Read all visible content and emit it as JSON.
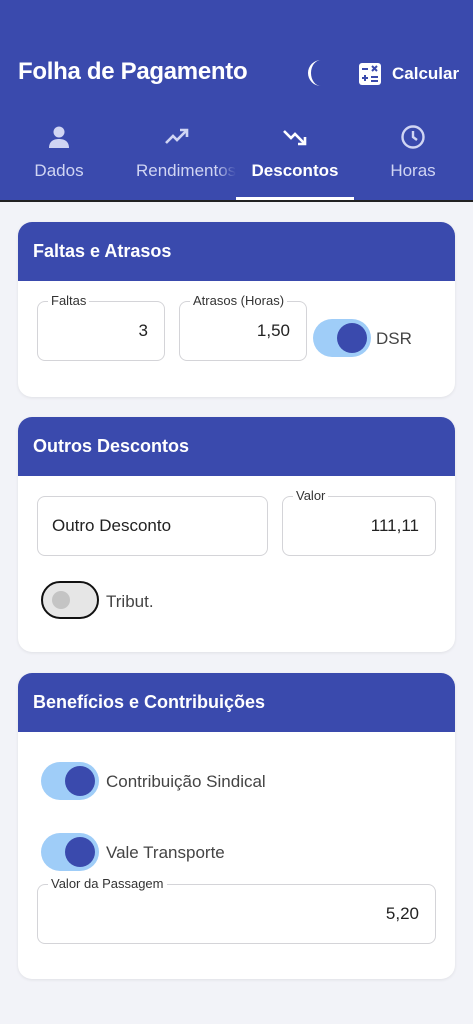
{
  "appbar": {
    "title": "Folha de Pagamento",
    "theme_icon": "moon-icon",
    "calc_icon": "calculator-icon",
    "calc_label": "Calcular"
  },
  "tabs": [
    {
      "label": "Dados",
      "icon": "person-icon",
      "active": false
    },
    {
      "label": "Rendimentos",
      "icon": "trending-up-icon",
      "active": false
    },
    {
      "label": "Descontos",
      "icon": "trending-down-icon",
      "active": true
    },
    {
      "label": "Horas",
      "icon": "clock-icon",
      "active": false
    }
  ],
  "faltas_atrasos": {
    "title": "Faltas e Atrasos",
    "faltas": {
      "label": "Faltas",
      "value": "3"
    },
    "atrasos": {
      "label": "Atrasos (Horas)",
      "value": "1,50"
    },
    "dsr": {
      "label": "DSR",
      "on": true
    }
  },
  "outros": {
    "title": "Outros Descontos",
    "descricao": "Outro Desconto",
    "valor": {
      "label": "Valor",
      "value": "111,11"
    },
    "tribut": {
      "label": "Tribut.",
      "on": false
    }
  },
  "beneficios": {
    "title": "Benefícios e Contribuições",
    "sindical": {
      "label": "Contribuição Sindical",
      "on": true
    },
    "transporte": {
      "label": "Vale Transporte",
      "on": true
    },
    "passagem": {
      "label": "Valor da Passagem",
      "value": "5,20"
    }
  },
  "colors": {
    "primary": "#3a4aad",
    "switch_track_on": "#9fcdf8",
    "background": "#f2f3f8"
  }
}
